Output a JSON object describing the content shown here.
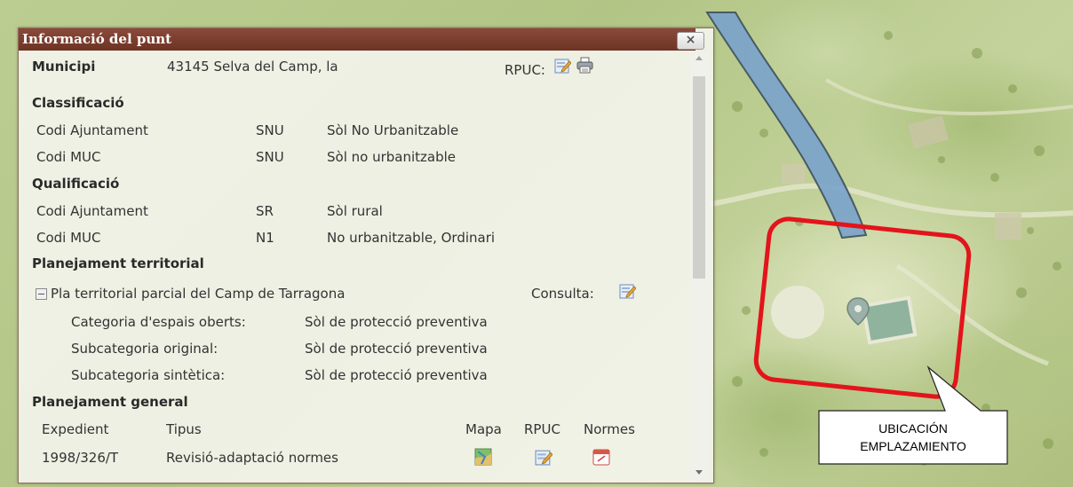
{
  "popup": {
    "title": "Informació del punt",
    "close_label": "×"
  },
  "municipi": {
    "label": "Municipi",
    "value": "43145 Selva del Camp, la",
    "rpuc_label": "RPUC:"
  },
  "classificacio": {
    "title": "Classificació",
    "rows": [
      {
        "label": "Codi Ajuntament",
        "code": "SNU",
        "desc": "Sòl No Urbanitzable"
      },
      {
        "label": "Codi MUC",
        "code": "SNU",
        "desc": "Sòl no urbanitzable"
      }
    ]
  },
  "qualificacio": {
    "title": "Qualificació",
    "rows": [
      {
        "label": "Codi Ajuntament",
        "code": "SR",
        "desc": "Sòl rural"
      },
      {
        "label": "Codi MUC",
        "code": "N1",
        "desc": "No urbanitzable, Ordinari"
      }
    ]
  },
  "planejament_territorial": {
    "title": "Planejament territorial",
    "plan_name": "Pla territorial parcial del Camp de Tarragona",
    "consulta_label": "Consulta:",
    "rows": [
      {
        "label": "Categoria d'espais oberts:",
        "value": "Sòl de protecció preventiva"
      },
      {
        "label": "Subcategoria original:",
        "value": "Sòl de protecció preventiva"
      },
      {
        "label": "Subcategoria sintètica:",
        "value": "Sòl de protecció preventiva"
      }
    ]
  },
  "planejament_general": {
    "title": "Planejament general",
    "headers": {
      "expedient": "Expedient",
      "tipus": "Tipus",
      "mapa": "Mapa",
      "rpuc": "RPUC",
      "normes": "Normes"
    },
    "rows": [
      {
        "expedient": "1998/326/T",
        "tipus": "Revisió-adaptació normes"
      }
    ]
  },
  "callout": {
    "line1": "UBICACIÓN",
    "line2": "EMPLAZAMIENTO"
  },
  "colors": {
    "header_bg": "#7a3d2e",
    "highlight_red": "#e3141b",
    "river_blue": "#6e9cc8"
  },
  "icons": [
    "edit-icon",
    "print-icon",
    "map-icon",
    "calendar-icon",
    "minus-icon",
    "location-pin-icon"
  ]
}
